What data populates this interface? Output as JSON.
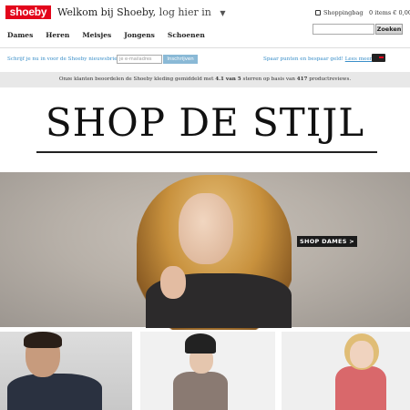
{
  "header": {
    "logo_text": "shoeby",
    "welcome": "Welkom bij Shoeby,",
    "login": "log hier in",
    "bag_label": "Shoppingbag",
    "bag_items": "0 items € 0,00"
  },
  "nav": {
    "items": [
      "Dames",
      "Heren",
      "Meisjes",
      "Jongens",
      "Schoenen"
    ]
  },
  "search": {
    "button_label": "Zoeken",
    "placeholder": ""
  },
  "newsletter": {
    "text": "Schrijf je nu in voor de Shoeby nieuwsbrief:",
    "input_placeholder": "je e-mailadres",
    "button_label": "Inschrijven",
    "points_text": "Spaar punten en bespaar geld!",
    "more_link": "Lees meer"
  },
  "review_bar": {
    "prefix": "Onze klanten beoordelen de Shoeby kleding gemiddeld met",
    "score": "4.1 van 5",
    "middle": "sterren op basis van",
    "count": "417",
    "suffix": "productreviews."
  },
  "headline": "SHOP DE STIJL",
  "hero": {
    "cta_label": "SHOP DAMES >"
  },
  "colors": {
    "brand": "#e3051b",
    "link": "#3a8fc9"
  }
}
